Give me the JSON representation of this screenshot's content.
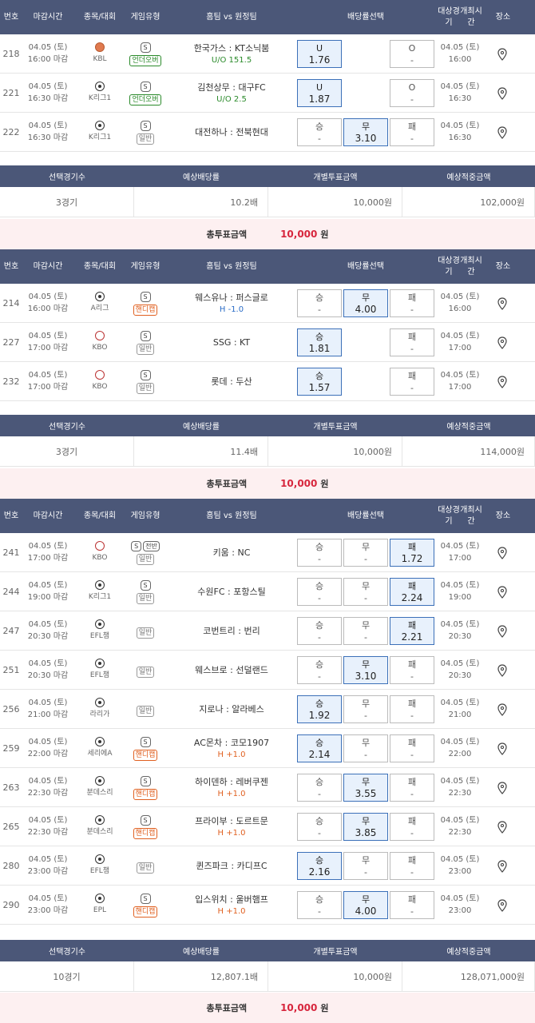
{
  "headers": {
    "num": "번호",
    "deadline": "마감시간",
    "sport": "종목/대회",
    "gametype": "게임유형",
    "match": "홈팀 vs 원정팀",
    "odds": "배당률선택",
    "start1": "대상경기",
    "start2": "개최시간",
    "place": "장소"
  },
  "summary_headers": {
    "count": "선택경기수",
    "odds": "예상배당률",
    "bet": "개별투표금액",
    "payout": "예상적중금액"
  },
  "total_label": "총투표금액",
  "sections": [
    {
      "rows": [
        {
          "num": "218",
          "date": "04.05 (토)",
          "deadline": "16:00 마감",
          "ball": "basketball",
          "league": "KBL",
          "half": "",
          "tag": "언더오버",
          "tagColor": "green",
          "match": "한국가스 : KT소닉붐",
          "sub": "U/O 151.5",
          "subColor": "green",
          "odds": [
            {
              "l": "U",
              "v": "1.76",
              "sel": true
            },
            {
              "l": "O",
              "v": "-",
              "sel": false
            }
          ],
          "type": "uo",
          "sd": "04.05 (토)",
          "st": "16:00"
        },
        {
          "num": "221",
          "date": "04.05 (토)",
          "deadline": "16:30 마감",
          "ball": "soccer",
          "league": "K리그1",
          "half": "",
          "tag": "언더오버",
          "tagColor": "green",
          "match": "김천상무 : 대구FC",
          "sub": "U/O 2.5",
          "subColor": "green",
          "odds": [
            {
              "l": "U",
              "v": "1.87",
              "sel": true
            },
            {
              "l": "O",
              "v": "-",
              "sel": false
            }
          ],
          "type": "uo",
          "sd": "04.05 (토)",
          "st": "16:30"
        },
        {
          "num": "222",
          "date": "04.05 (토)",
          "deadline": "16:30 마감",
          "ball": "soccer",
          "league": "K리그1",
          "half": "",
          "tag": "일반",
          "tagColor": "gray",
          "match": "대전하나 : 전북현대",
          "sub": "",
          "subColor": "",
          "odds": [
            {
              "l": "승",
              "v": "-",
              "sel": false
            },
            {
              "l": "무",
              "v": "3.10",
              "sel": true
            },
            {
              "l": "패",
              "v": "-",
              "sel": false
            }
          ],
          "type": "wdl",
          "sd": "04.05 (토)",
          "st": "16:30"
        }
      ],
      "summary": {
        "count": "3경기",
        "odds": "10.2배",
        "bet": "10,000원",
        "payout": "102,000원"
      },
      "total": {
        "value": "10,000",
        "unit": "원"
      }
    },
    {
      "rows": [
        {
          "num": "214",
          "date": "04.05 (토)",
          "deadline": "16:00 마감",
          "ball": "soccer",
          "league": "A리그",
          "half": "",
          "tag": "핸디캡",
          "tagColor": "orange",
          "match": "웨스유나 : 퍼스글로",
          "sub": "H -1.0",
          "subColor": "blue",
          "odds": [
            {
              "l": "승",
              "v": "-",
              "sel": false
            },
            {
              "l": "무",
              "v": "4.00",
              "sel": true
            },
            {
              "l": "패",
              "v": "-",
              "sel": false
            }
          ],
          "type": "wdl",
          "sd": "04.05 (토)",
          "st": "16:00"
        },
        {
          "num": "227",
          "date": "04.05 (토)",
          "deadline": "17:00 마감",
          "ball": "baseball",
          "league": "KBO",
          "half": "",
          "tag": "일반",
          "tagColor": "gray",
          "match": "SSG : KT",
          "sub": "",
          "subColor": "",
          "odds": [
            {
              "l": "승",
              "v": "1.81",
              "sel": true
            },
            {
              "l": "패",
              "v": "-",
              "sel": false
            }
          ],
          "type": "wl",
          "sd": "04.05 (토)",
          "st": "17:00"
        },
        {
          "num": "232",
          "date": "04.05 (토)",
          "deadline": "17:00 마감",
          "ball": "baseball",
          "league": "KBO",
          "half": "",
          "tag": "일반",
          "tagColor": "gray",
          "match": "롯데 : 두산",
          "sub": "",
          "subColor": "",
          "odds": [
            {
              "l": "승",
              "v": "1.57",
              "sel": true
            },
            {
              "l": "패",
              "v": "-",
              "sel": false
            }
          ],
          "type": "wl",
          "sd": "04.05 (토)",
          "st": "17:00"
        }
      ],
      "summary": {
        "count": "3경기",
        "odds": "11.4배",
        "bet": "10,000원",
        "payout": "114,000원"
      },
      "total": {
        "value": "10,000",
        "unit": "원"
      }
    },
    {
      "rows": [
        {
          "num": "241",
          "date": "04.05 (토)",
          "deadline": "17:00 마감",
          "ball": "baseball",
          "league": "KBO",
          "half": "전반",
          "tag": "일반",
          "tagColor": "gray",
          "match": "키움 : NC",
          "sub": "",
          "subColor": "",
          "odds": [
            {
              "l": "승",
              "v": "-",
              "sel": false
            },
            {
              "l": "무",
              "v": "-",
              "sel": false
            },
            {
              "l": "패",
              "v": "1.72",
              "sel": true
            }
          ],
          "type": "wdl",
          "sd": "04.05 (토)",
          "st": "17:00"
        },
        {
          "num": "244",
          "date": "04.05 (토)",
          "deadline": "19:00 마감",
          "ball": "soccer",
          "league": "K리그1",
          "half": "",
          "tag": "일반",
          "tagColor": "gray",
          "match": "수원FC : 포항스틸",
          "sub": "",
          "subColor": "",
          "odds": [
            {
              "l": "승",
              "v": "-",
              "sel": false
            },
            {
              "l": "무",
              "v": "-",
              "sel": false
            },
            {
              "l": "패",
              "v": "2.24",
              "sel": true
            }
          ],
          "type": "wdl",
          "sd": "04.05 (토)",
          "st": "19:00"
        },
        {
          "num": "247",
          "date": "04.05 (토)",
          "deadline": "20:30 마감",
          "ball": "soccer",
          "league": "EFL챔",
          "half": "none",
          "tag": "일반",
          "tagColor": "gray",
          "match": "코번트리 : 번리",
          "sub": "",
          "subColor": "",
          "odds": [
            {
              "l": "승",
              "v": "-",
              "sel": false
            },
            {
              "l": "무",
              "v": "-",
              "sel": false
            },
            {
              "l": "패",
              "v": "2.21",
              "sel": true
            }
          ],
          "type": "wdl",
          "sd": "04.05 (토)",
          "st": "20:30"
        },
        {
          "num": "251",
          "date": "04.05 (토)",
          "deadline": "20:30 마감",
          "ball": "soccer",
          "league": "EFL챔",
          "half": "none",
          "tag": "일반",
          "tagColor": "gray",
          "match": "웨스브로 : 선덜랜드",
          "sub": "",
          "subColor": "",
          "odds": [
            {
              "l": "승",
              "v": "-",
              "sel": false
            },
            {
              "l": "무",
              "v": "3.10",
              "sel": true
            },
            {
              "l": "패",
              "v": "-",
              "sel": false
            }
          ],
          "type": "wdl",
          "sd": "04.05 (토)",
          "st": "20:30"
        },
        {
          "num": "256",
          "date": "04.05 (토)",
          "deadline": "21:00 마감",
          "ball": "soccer",
          "league": "라리가",
          "half": "none",
          "tag": "일반",
          "tagColor": "gray",
          "match": "지로나 : 알라베스",
          "sub": "",
          "subColor": "",
          "odds": [
            {
              "l": "승",
              "v": "1.92",
              "sel": true
            },
            {
              "l": "무",
              "v": "-",
              "sel": false
            },
            {
              "l": "패",
              "v": "-",
              "sel": false
            }
          ],
          "type": "wdl",
          "sd": "04.05 (토)",
          "st": "21:00"
        },
        {
          "num": "259",
          "date": "04.05 (토)",
          "deadline": "22:00 마감",
          "ball": "soccer",
          "league": "세리에A",
          "half": "",
          "tag": "핸디캡",
          "tagColor": "orange",
          "match": "AC몬차 : 코모1907",
          "sub": "H +1.0",
          "subColor": "orange",
          "odds": [
            {
              "l": "승",
              "v": "2.14",
              "sel": true
            },
            {
              "l": "무",
              "v": "-",
              "sel": false
            },
            {
              "l": "패",
              "v": "-",
              "sel": false
            }
          ],
          "type": "wdl",
          "sd": "04.05 (토)",
          "st": "22:00"
        },
        {
          "num": "263",
          "date": "04.05 (토)",
          "deadline": "22:30 마감",
          "ball": "soccer",
          "league": "분데스리",
          "half": "",
          "tag": "핸디캡",
          "tagColor": "orange",
          "match": "하이덴하 : 레버쿠젠",
          "sub": "H +1.0",
          "subColor": "orange",
          "odds": [
            {
              "l": "승",
              "v": "-",
              "sel": false
            },
            {
              "l": "무",
              "v": "3.55",
              "sel": true
            },
            {
              "l": "패",
              "v": "-",
              "sel": false
            }
          ],
          "type": "wdl",
          "sd": "04.05 (토)",
          "st": "22:30"
        },
        {
          "num": "265",
          "date": "04.05 (토)",
          "deadline": "22:30 마감",
          "ball": "soccer",
          "league": "분데스리",
          "half": "",
          "tag": "핸디캡",
          "tagColor": "orange",
          "match": "프라이부 : 도르트문",
          "sub": "H +1.0",
          "subColor": "orange",
          "odds": [
            {
              "l": "승",
              "v": "-",
              "sel": false
            },
            {
              "l": "무",
              "v": "3.85",
              "sel": true
            },
            {
              "l": "패",
              "v": "-",
              "sel": false
            }
          ],
          "type": "wdl",
          "sd": "04.05 (토)",
          "st": "22:30"
        },
        {
          "num": "280",
          "date": "04.05 (토)",
          "deadline": "23:00 마감",
          "ball": "soccer",
          "league": "EFL챔",
          "half": "none",
          "tag": "일반",
          "tagColor": "gray",
          "match": "퀸즈파크 : 카디프C",
          "sub": "",
          "subColor": "",
          "odds": [
            {
              "l": "승",
              "v": "2.16",
              "sel": true
            },
            {
              "l": "무",
              "v": "-",
              "sel": false
            },
            {
              "l": "패",
              "v": "-",
              "sel": false
            }
          ],
          "type": "wdl",
          "sd": "04.05 (토)",
          "st": "23:00"
        },
        {
          "num": "290",
          "date": "04.05 (토)",
          "deadline": "23:00 마감",
          "ball": "soccer",
          "league": "EPL",
          "half": "",
          "tag": "핸디캡",
          "tagColor": "orange",
          "match": "입스위치 : 울버햄프",
          "sub": "H +1.0",
          "subColor": "orange",
          "odds": [
            {
              "l": "승",
              "v": "-",
              "sel": false
            },
            {
              "l": "무",
              "v": "4.00",
              "sel": true
            },
            {
              "l": "패",
              "v": "-",
              "sel": false
            }
          ],
          "type": "wdl",
          "sd": "04.05 (토)",
          "st": "23:00"
        }
      ],
      "summary": {
        "count": "10경기",
        "odds": "12,807.1배",
        "bet": "10,000원",
        "payout": "128,071,000원"
      },
      "total": {
        "value": "10,000",
        "unit": "원"
      }
    }
  ]
}
